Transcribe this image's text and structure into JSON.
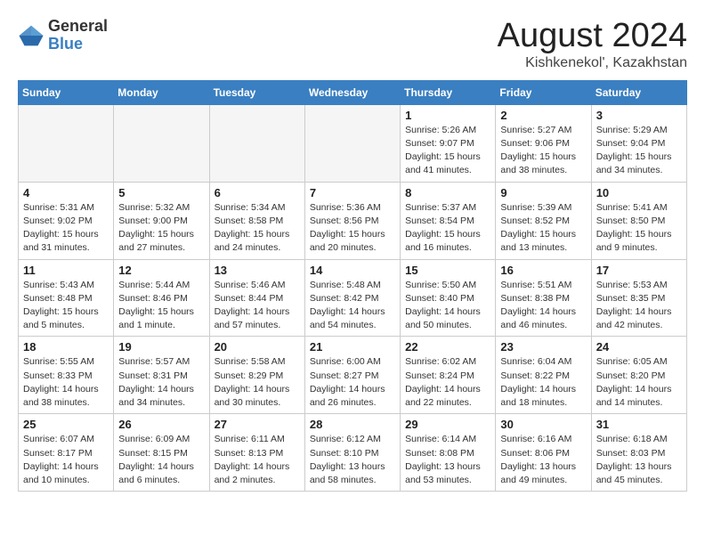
{
  "logo": {
    "general": "General",
    "blue": "Blue"
  },
  "title": {
    "month_year": "August 2024",
    "location": "Kishkenekol', Kazakhstan"
  },
  "weekdays": [
    "Sunday",
    "Monday",
    "Tuesday",
    "Wednesday",
    "Thursday",
    "Friday",
    "Saturday"
  ],
  "weeks": [
    [
      {
        "day": "",
        "info": ""
      },
      {
        "day": "",
        "info": ""
      },
      {
        "day": "",
        "info": ""
      },
      {
        "day": "",
        "info": ""
      },
      {
        "day": "1",
        "info": "Sunrise: 5:26 AM\nSunset: 9:07 PM\nDaylight: 15 hours\nand 41 minutes."
      },
      {
        "day": "2",
        "info": "Sunrise: 5:27 AM\nSunset: 9:06 PM\nDaylight: 15 hours\nand 38 minutes."
      },
      {
        "day": "3",
        "info": "Sunrise: 5:29 AM\nSunset: 9:04 PM\nDaylight: 15 hours\nand 34 minutes."
      }
    ],
    [
      {
        "day": "4",
        "info": "Sunrise: 5:31 AM\nSunset: 9:02 PM\nDaylight: 15 hours\nand 31 minutes."
      },
      {
        "day": "5",
        "info": "Sunrise: 5:32 AM\nSunset: 9:00 PM\nDaylight: 15 hours\nand 27 minutes."
      },
      {
        "day": "6",
        "info": "Sunrise: 5:34 AM\nSunset: 8:58 PM\nDaylight: 15 hours\nand 24 minutes."
      },
      {
        "day": "7",
        "info": "Sunrise: 5:36 AM\nSunset: 8:56 PM\nDaylight: 15 hours\nand 20 minutes."
      },
      {
        "day": "8",
        "info": "Sunrise: 5:37 AM\nSunset: 8:54 PM\nDaylight: 15 hours\nand 16 minutes."
      },
      {
        "day": "9",
        "info": "Sunrise: 5:39 AM\nSunset: 8:52 PM\nDaylight: 15 hours\nand 13 minutes."
      },
      {
        "day": "10",
        "info": "Sunrise: 5:41 AM\nSunset: 8:50 PM\nDaylight: 15 hours\nand 9 minutes."
      }
    ],
    [
      {
        "day": "11",
        "info": "Sunrise: 5:43 AM\nSunset: 8:48 PM\nDaylight: 15 hours\nand 5 minutes."
      },
      {
        "day": "12",
        "info": "Sunrise: 5:44 AM\nSunset: 8:46 PM\nDaylight: 15 hours\nand 1 minute."
      },
      {
        "day": "13",
        "info": "Sunrise: 5:46 AM\nSunset: 8:44 PM\nDaylight: 14 hours\nand 57 minutes."
      },
      {
        "day": "14",
        "info": "Sunrise: 5:48 AM\nSunset: 8:42 PM\nDaylight: 14 hours\nand 54 minutes."
      },
      {
        "day": "15",
        "info": "Sunrise: 5:50 AM\nSunset: 8:40 PM\nDaylight: 14 hours\nand 50 minutes."
      },
      {
        "day": "16",
        "info": "Sunrise: 5:51 AM\nSunset: 8:38 PM\nDaylight: 14 hours\nand 46 minutes."
      },
      {
        "day": "17",
        "info": "Sunrise: 5:53 AM\nSunset: 8:35 PM\nDaylight: 14 hours\nand 42 minutes."
      }
    ],
    [
      {
        "day": "18",
        "info": "Sunrise: 5:55 AM\nSunset: 8:33 PM\nDaylight: 14 hours\nand 38 minutes."
      },
      {
        "day": "19",
        "info": "Sunrise: 5:57 AM\nSunset: 8:31 PM\nDaylight: 14 hours\nand 34 minutes."
      },
      {
        "day": "20",
        "info": "Sunrise: 5:58 AM\nSunset: 8:29 PM\nDaylight: 14 hours\nand 30 minutes."
      },
      {
        "day": "21",
        "info": "Sunrise: 6:00 AM\nSunset: 8:27 PM\nDaylight: 14 hours\nand 26 minutes."
      },
      {
        "day": "22",
        "info": "Sunrise: 6:02 AM\nSunset: 8:24 PM\nDaylight: 14 hours\nand 22 minutes."
      },
      {
        "day": "23",
        "info": "Sunrise: 6:04 AM\nSunset: 8:22 PM\nDaylight: 14 hours\nand 18 minutes."
      },
      {
        "day": "24",
        "info": "Sunrise: 6:05 AM\nSunset: 8:20 PM\nDaylight: 14 hours\nand 14 minutes."
      }
    ],
    [
      {
        "day": "25",
        "info": "Sunrise: 6:07 AM\nSunset: 8:17 PM\nDaylight: 14 hours\nand 10 minutes."
      },
      {
        "day": "26",
        "info": "Sunrise: 6:09 AM\nSunset: 8:15 PM\nDaylight: 14 hours\nand 6 minutes."
      },
      {
        "day": "27",
        "info": "Sunrise: 6:11 AM\nSunset: 8:13 PM\nDaylight: 14 hours\nand 2 minutes."
      },
      {
        "day": "28",
        "info": "Sunrise: 6:12 AM\nSunset: 8:10 PM\nDaylight: 13 hours\nand 58 minutes."
      },
      {
        "day": "29",
        "info": "Sunrise: 6:14 AM\nSunset: 8:08 PM\nDaylight: 13 hours\nand 53 minutes."
      },
      {
        "day": "30",
        "info": "Sunrise: 6:16 AM\nSunset: 8:06 PM\nDaylight: 13 hours\nand 49 minutes."
      },
      {
        "day": "31",
        "info": "Sunrise: 6:18 AM\nSunset: 8:03 PM\nDaylight: 13 hours\nand 45 minutes."
      }
    ]
  ]
}
